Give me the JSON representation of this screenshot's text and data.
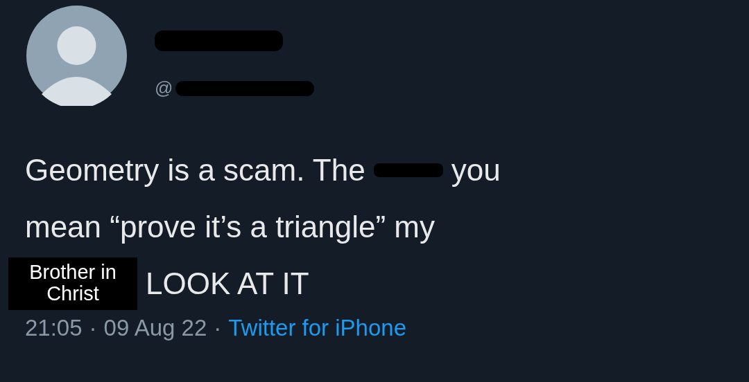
{
  "author": {
    "name_redacted": true,
    "handle_prefix": "@",
    "handle_redacted": true
  },
  "tweet": {
    "lines": [
      [
        {
          "kind": "text",
          "text": "Geometry is a scam. The"
        },
        {
          "kind": "redaction"
        },
        {
          "kind": "text",
          "text": "you"
        }
      ],
      [
        {
          "kind": "text",
          "text": "mean “prove it’s a triangle” my"
        }
      ],
      [
        {
          "kind": "label",
          "text": "Brother in Christ"
        },
        {
          "kind": "text",
          "text": "LOOK AT IT"
        }
      ]
    ]
  },
  "meta": {
    "time": "21:05",
    "separator_1": "·",
    "date": "09 Aug 22",
    "separator_2": "·",
    "source": "Twitter for iPhone"
  }
}
